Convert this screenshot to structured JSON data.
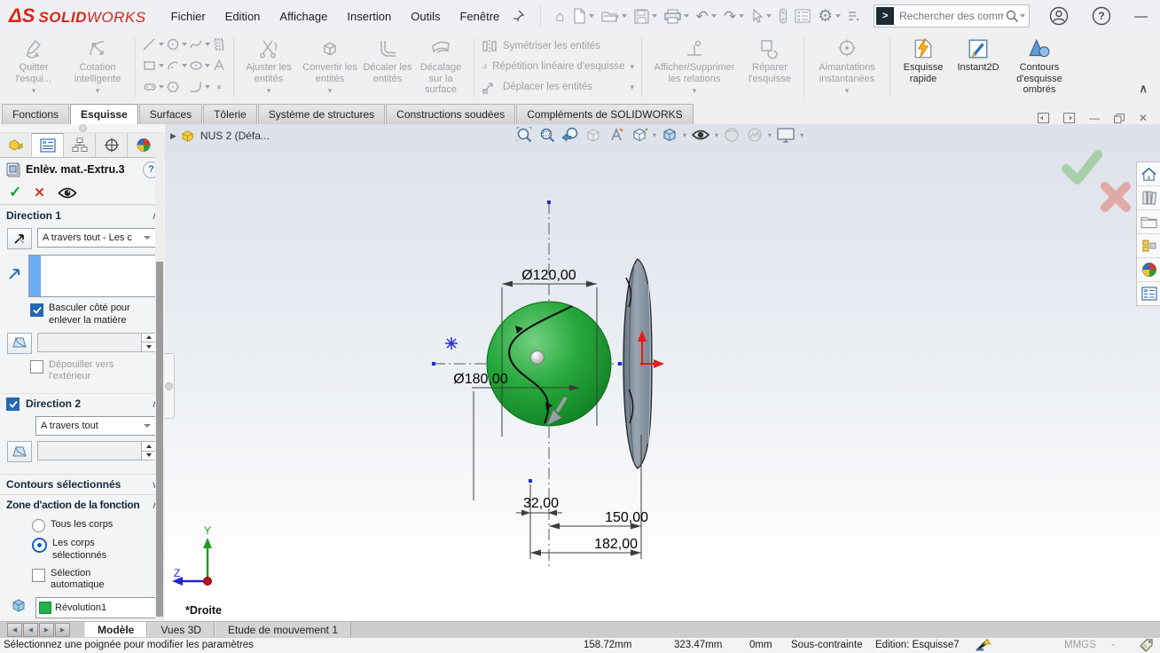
{
  "titlebar": {
    "logo_glyph": "ΔS",
    "logo_bold": "SOLID",
    "logo_light": "WORKS",
    "menus": [
      "Fichier",
      "Edition",
      "Affichage",
      "Insertion",
      "Outils",
      "Fenêtre"
    ],
    "search_placeholder": "Rechercher des comm"
  },
  "icons": {
    "dropdown": "▾",
    "collapse": "∧",
    "expand": "∨",
    "ok": "✓",
    "cancel": "✕",
    "help": "?",
    "flyout": "▶",
    "home": "⌂",
    "undo": "↶",
    "redo": "↷",
    "gear": "⚙",
    "prompt": ">",
    "minimize": "—",
    "nav_back": "◀",
    "nav_fwd": "▶"
  },
  "ribbon": {
    "exit_sketch": "Quitter l'esqui...",
    "smart_dimension": "Cotation intelligente",
    "trim": "Ajuster les entités",
    "convert": "Convertir les entités",
    "offset": "Décaler les entités",
    "surface_offset": "Décalage sur la surface",
    "mirror": "Symétriser les entités",
    "linear_pattern": "Répétition linéaire d'esquisse",
    "move": "Déplacer les entités",
    "display_relations": "Afficher/Supprimer les relations",
    "repair": "Réparer l'esquisse",
    "snaps": "Aimantations instantanées",
    "rapid": "Esquisse rapide",
    "instant2d": "Instant2D",
    "shaded": "Contours d'esquisse ombrés"
  },
  "command_tabs": {
    "items": [
      "Fonctions",
      "Esquisse",
      "Surfaces",
      "Tôlerie",
      "Système de structures",
      "Constructions soudées",
      "Compléments de SOLIDWORKS"
    ],
    "active": "Esquisse"
  },
  "property_manager": {
    "title": "Enlèv. mat.-Extru.3",
    "direction1": {
      "header": "Direction 1",
      "end_condition": "A travers tout - Les c",
      "flip_side": "Basculer côté pour enlever la matière",
      "draft_outward": "Dépouiller vers l'extérieur"
    },
    "direction2": {
      "header": "Direction 2",
      "end_condition": "A travers tout"
    },
    "selected_contours": {
      "header": "Contours sélectionnés"
    },
    "feature_scope": {
      "header": "Zone d'action de la fonction",
      "all_bodies": "Tous les corps",
      "selected_bodies": "Les corps sélectionnés",
      "auto_select": "Sélection automatique",
      "bodies": [
        "Révolution1"
      ]
    }
  },
  "viewport": {
    "breadcrumb": "NUS 2  (Défa...",
    "view_label": "*Droite",
    "triad": {
      "y": "Y",
      "z": "Z"
    },
    "dimensions": {
      "dia_small": "Ø120,00",
      "dia_large": "Ø180,00",
      "width_small": "32,00",
      "width_mid": "150,00",
      "width_large": "182,00"
    }
  },
  "model_tabs": {
    "items": [
      "Modèle",
      "Vues 3D",
      "Etude de mouvement 1"
    ],
    "active": "Modèle"
  },
  "statusbar": {
    "message": "Sélectionnez une poignée pour modifier les paramètres",
    "coord_x": "158.72mm",
    "coord_y": "323.47mm",
    "coord_z": "0mm",
    "constraint_state": "Sous-contrainte",
    "editing": "Edition: Esquisse7",
    "units": "MMGS",
    "units_dash": "-"
  }
}
